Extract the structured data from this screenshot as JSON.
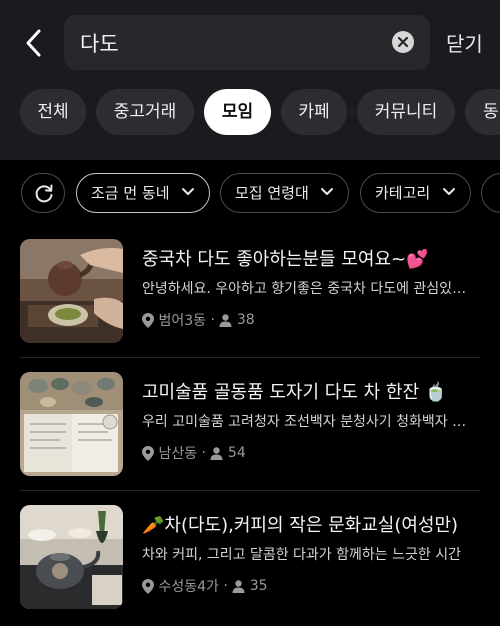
{
  "search": {
    "query": "다도"
  },
  "header": {
    "close_label": "닫기",
    "back_icon": "chevron-left-icon",
    "clear_icon": "clear-icon"
  },
  "tabs": [
    {
      "label": "전체"
    },
    {
      "label": "중고거래"
    },
    {
      "label": "모임",
      "active": true
    },
    {
      "label": "카페"
    },
    {
      "label": "커뮤니티"
    },
    {
      "label": "동"
    }
  ],
  "filters": [
    {
      "label": "조금 먼 동네",
      "selected": true
    },
    {
      "label": "모집 연령대"
    },
    {
      "label": "카테고리"
    }
  ],
  "results": [
    {
      "title": "중국차 다도 좋아하는분들 모여요~💕",
      "desc": "안녕하세요. 우아하고 향기좋은 중국차 다도에 관심있으신 분들",
      "location": "범어3동",
      "members": "38"
    },
    {
      "title": "고미술품 골동품 도자기 다도 차 한잔 🍵",
      "desc": "우리 고미술품 고려청자 조선백자 분청사기 청화백자 도자기",
      "location": "남산동",
      "members": "54"
    },
    {
      "title": "🥕차(다도),커피의 작은 문화교실(여성만)",
      "desc": "차와 커피, 그리고 달콤한 다과가 함께하는 느긋한 시간",
      "location": "수성동4가",
      "members": "35"
    }
  ],
  "colors": {
    "background": "#000000",
    "topbar": "#1a1b1e",
    "active_tab": "#ffffff",
    "chip_border": "#4a4b50"
  }
}
